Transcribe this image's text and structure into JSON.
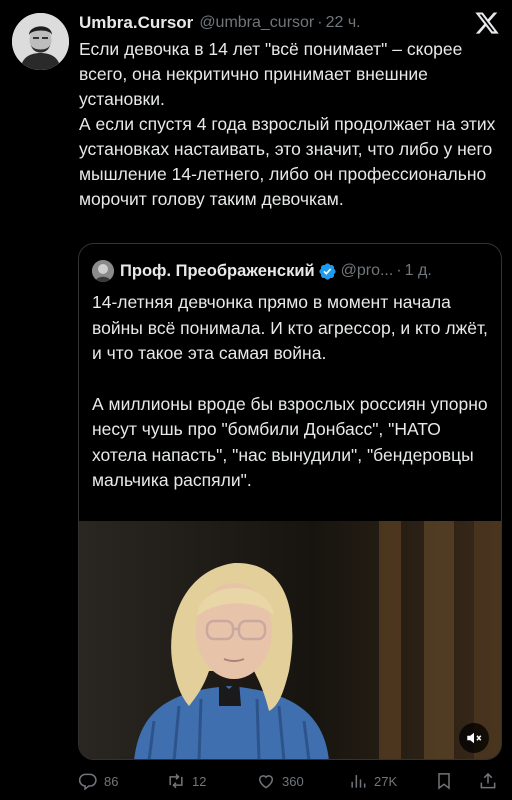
{
  "tweet": {
    "author": {
      "display_name": "Umbra.Cursor",
      "handle": "@umbra_cursor",
      "separator": "·",
      "time": "22 ч."
    },
    "logo_icon": "x-logo-icon",
    "text": [
      "Если девочка в 14 лет \"всё понимает\" – скорее всего, она некритично принимает внешние установки.",
      "А если спустя 4 года взрослый продолжает на этих установках настаивать, это значит, что либо у него мышление 14-летнего, либо он профессионально морочит голову таким девочкам."
    ]
  },
  "quote": {
    "author": {
      "display_name": "Проф. Преображенский",
      "handle": "@pro...",
      "separator": "·",
      "time": "1 д.",
      "verified_icon": "verified-badge-icon"
    },
    "text": [
      "14-летняя девчонка прямо в момент начала войны всё понимала. И кто агрессор, и кто лжёт, и что такое эта самая война.",
      "А миллионы вроде бы взрослых россиян упорно несут чушь про \"бомбили Донбасс\", \"НАТО хотела напасть\", \"нас вынудили\", \"бендеровцы мальчика распяли\"."
    ],
    "media": {
      "type": "video",
      "mute_icon": "muted-speaker-icon"
    }
  },
  "actions": {
    "reply": {
      "icon": "reply-icon",
      "count": "86"
    },
    "retweet": {
      "icon": "retweet-icon",
      "count": "12"
    },
    "like": {
      "icon": "heart-icon",
      "count": "360"
    },
    "views": {
      "icon": "views-chart-icon",
      "count": "27K"
    },
    "bookmark": {
      "icon": "bookmark-icon"
    },
    "share": {
      "icon": "share-icon"
    }
  },
  "colors": {
    "background": "#000000",
    "text": "#e7e9ea",
    "secondary": "#71767b",
    "border": "#2f3336",
    "verified": "#1d9bf0"
  }
}
